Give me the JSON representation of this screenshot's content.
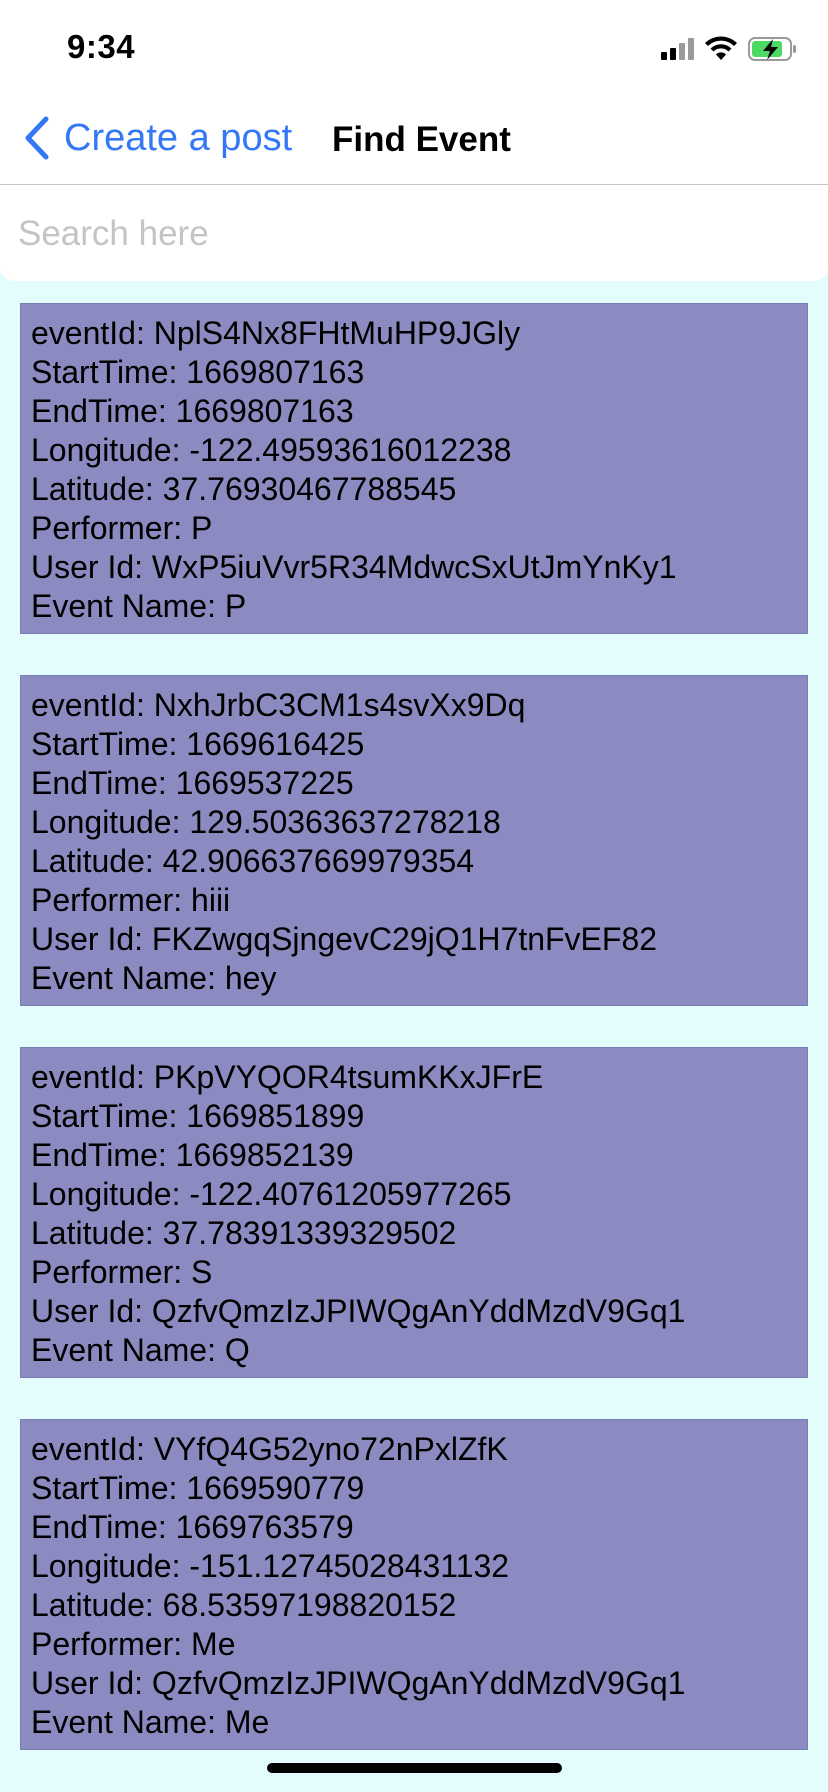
{
  "status_bar": {
    "time": "9:34",
    "icons": [
      "cellular-signal-icon",
      "wifi-icon",
      "battery-charging-icon"
    ],
    "battery_color": "#4cd964"
  },
  "nav": {
    "back_label": "Create a post",
    "title": "Find Event",
    "accent_color": "#3478f6"
  },
  "search": {
    "value": "",
    "placeholder": "Search here"
  },
  "events": [
    {
      "event_id": "eventId: NplS4Nx8FHtMuHP9JGly",
      "start_time": "StartTime: 1669807163",
      "end_time": "EndTime: 1669807163",
      "longitude": "Longitude: -122.49593616012238",
      "latitude": "Latitude: 37.76930467788545",
      "performer": "Performer: P",
      "user_id": "User Id: WxP5iuVvr5R34MdwcSxUtJmYnKy1",
      "event_name": "Event Name: P"
    },
    {
      "event_id": "eventId: NxhJrbC3CM1s4svXx9Dq",
      "start_time": "StartTime: 1669616425",
      "end_time": "EndTime: 1669537225",
      "longitude": "Longitude: 129.50363637278218",
      "latitude": "Latitude: 42.906637669979354",
      "performer": "Performer: hiii",
      "user_id": "User Id: FKZwgqSjngevC29jQ1H7tnFvEF82",
      "event_name": "Event Name: hey"
    },
    {
      "event_id": "eventId: PKpVYQOR4tsumKKxJFrE",
      "start_time": "StartTime: 1669851899",
      "end_time": "EndTime: 1669852139",
      "longitude": "Longitude: -122.40761205977265",
      "latitude": "Latitude: 37.78391339329502",
      "performer": "Performer: S",
      "user_id": "User Id: QzfvQmzIzJPIWQgAnYddMzdV9Gq1",
      "event_name": "Event Name: Q"
    },
    {
      "event_id": "eventId: VYfQ4G52yno72nPxlZfK",
      "start_time": "StartTime: 1669590779",
      "end_time": "EndTime: 1669763579",
      "longitude": "Longitude: -151.12745028431132",
      "latitude": "Latitude: 68.53597198820152",
      "performer": "Performer: Me",
      "user_id": "User Id: QzfvQmzIzJPIWQgAnYddMzdV9Gq1",
      "event_name": "Event Name: Me"
    }
  ],
  "colors": {
    "page_background": "#e3fdfd",
    "card_background": "#8b8bc1"
  }
}
